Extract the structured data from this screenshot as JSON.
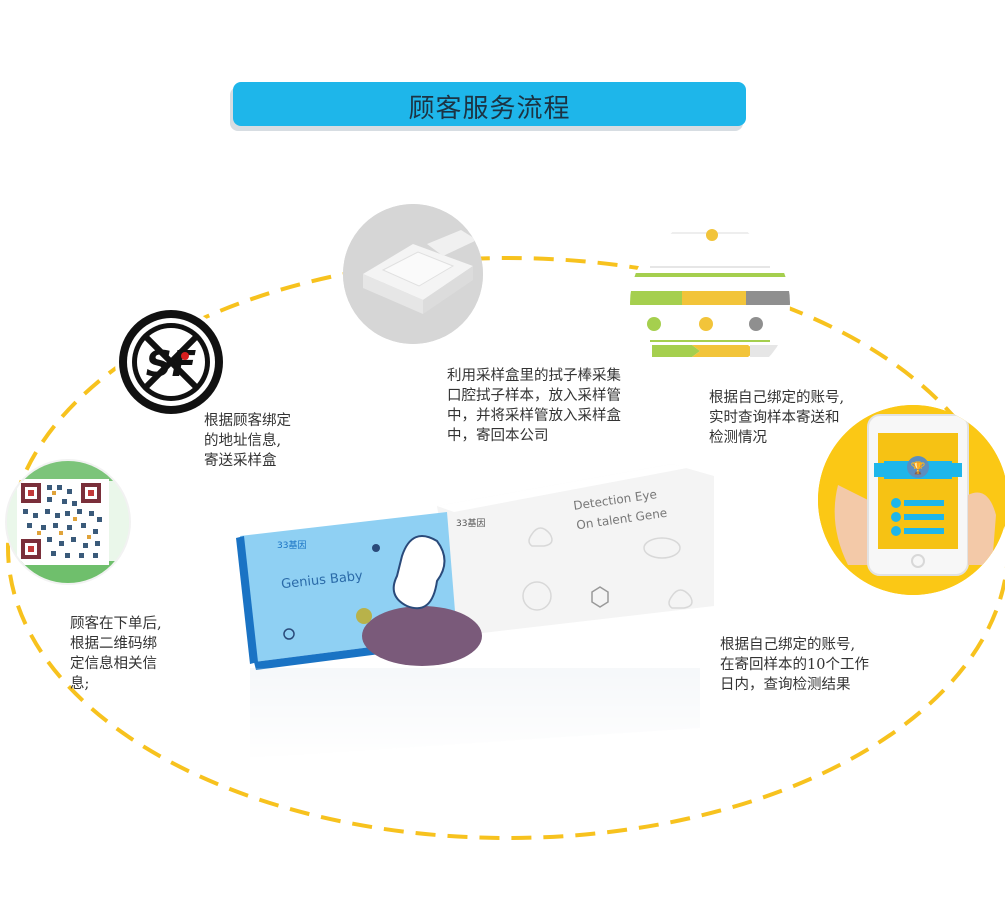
{
  "banner": {
    "title": "顾客服务流程"
  },
  "steps": [
    {
      "id": "order",
      "icon": "qr-code-icon",
      "lines": [
        "顾客在下单后,",
        "根据二维码绑",
        "定信息相关信",
        "息;"
      ]
    },
    {
      "id": "ship",
      "icon": "sf-express-logo",
      "lines": [
        "根据顾客绑定",
        "的地址信息,",
        "寄送采样盒"
      ]
    },
    {
      "id": "sample",
      "icon": "sample-box-icon",
      "lines": [
        "利用采样盒里的拭子棒采集",
        "口腔拭子样本，放入采样管",
        "中，并将采样管放入采样盒",
        "中，寄回本公司"
      ]
    },
    {
      "id": "track",
      "icon": "progress-steps-icon",
      "lines": [
        "根据自己绑定的账号,",
        "实时查询样本寄送和",
        "检测情况"
      ]
    },
    {
      "id": "result",
      "icon": "phone-results-icon",
      "lines": [
        "根据自己绑定的账号,",
        "在寄回样本的10个工作",
        "日内，查询检测结果"
      ]
    }
  ],
  "product": {
    "brand": "33基因",
    "left_name": "Genius Baby",
    "right_line1": "Detection Eye",
    "right_line2": "On talent Gene"
  },
  "colors": {
    "banner": "#1eb6ea",
    "orbit": "#f7c21e",
    "phone_bg": "#fbc815",
    "box_blue": "#7ac3ee"
  }
}
